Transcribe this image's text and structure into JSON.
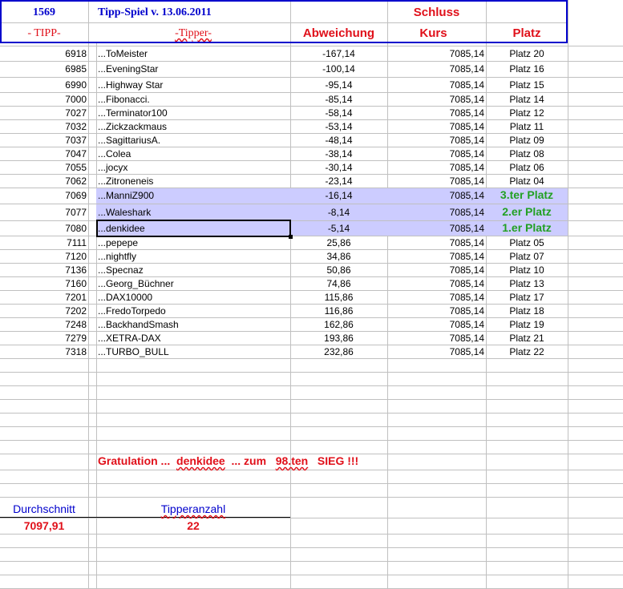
{
  "header": {
    "id": "1569",
    "title": "Tipp-Spiel v. 13.06.2011",
    "schluss": "Schluss",
    "col_tipp": "- TIPP-",
    "col_tipper": "-Tipper-",
    "col_abweichung": "Abweichung",
    "col_kurs": "Kurs",
    "col_platz": "Platz"
  },
  "rows": [
    {
      "tipp": "6918",
      "name": "...ToMeister",
      "abw": "-167,14",
      "kurs": "7085,14",
      "platz": "Platz 20"
    },
    {
      "tipp": "6985",
      "name": "...EveningStar",
      "abw": "-100,14",
      "kurs": "7085,14",
      "platz": "Platz 16"
    },
    {
      "tipp": "6990",
      "name": "...Highway Star",
      "abw": "-95,14",
      "kurs": "7085,14",
      "platz": "Platz 15"
    },
    {
      "tipp": "7000",
      "name": "...Fibonacci.",
      "abw": "-85,14",
      "kurs": "7085,14",
      "platz": "Platz 14"
    },
    {
      "tipp": "7027",
      "name": "...Terminator100",
      "abw": "-58,14",
      "kurs": "7085,14",
      "platz": "Platz 12"
    },
    {
      "tipp": "7032",
      "name": "...Zickzackmaus",
      "abw": "-53,14",
      "kurs": "7085,14",
      "platz": "Platz 11"
    },
    {
      "tipp": "7037",
      "name": "...SagittariusA.",
      "abw": "-48,14",
      "kurs": "7085,14",
      "platz": "Platz 09"
    },
    {
      "tipp": "7047",
      "name": "...Colea",
      "abw": "-38,14",
      "kurs": "7085,14",
      "platz": "Platz 08"
    },
    {
      "tipp": "7055",
      "name": "...jocyx",
      "abw": "-30,14",
      "kurs": "7085,14",
      "platz": "Platz 06"
    },
    {
      "tipp": "7062",
      "name": "...Zitroneneis",
      "abw": "-23,14",
      "kurs": "7085,14",
      "platz": "Platz 04"
    },
    {
      "tipp": "7069",
      "name": "...ManniZ900",
      "abw": "-16,14",
      "kurs": "7085,14",
      "platz": "3.ter Platz",
      "winner": true
    },
    {
      "tipp": "7077",
      "name": "...Waleshark",
      "abw": "-8,14",
      "kurs": "7085,14",
      "platz": "2.er Platz",
      "winner": true
    },
    {
      "tipp": "7080",
      "name": "...denkidee",
      "abw": "-5,14",
      "kurs": "7085,14",
      "platz": "1.er Platz",
      "winner": true,
      "selected": true
    },
    {
      "tipp": "7111",
      "name": "...pepepe",
      "abw": "25,86",
      "kurs": "7085,14",
      "platz": "Platz 05"
    },
    {
      "tipp": "7120",
      "name": "...nightfly",
      "abw": "34,86",
      "kurs": "7085,14",
      "platz": "Platz 07"
    },
    {
      "tipp": "7136",
      "name": "...Specnaz",
      "abw": "50,86",
      "kurs": "7085,14",
      "platz": "Platz 10"
    },
    {
      "tipp": "7160",
      "name": "...Georg_Büchner",
      "abw": "74,86",
      "kurs": "7085,14",
      "platz": "Platz 13"
    },
    {
      "tipp": "7201",
      "name": "...DAX10000",
      "abw": "115,86",
      "kurs": "7085,14",
      "platz": "Platz 17"
    },
    {
      "tipp": "7202",
      "name": "...FredoTorpedo",
      "abw": "116,86",
      "kurs": "7085,14",
      "platz": "Platz 18"
    },
    {
      "tipp": "7248",
      "name": "...BackhandSmash",
      "abw": "162,86",
      "kurs": "7085,14",
      "platz": "Platz 19"
    },
    {
      "tipp": "7279",
      "name": "...XETRA-DAX",
      "abw": "193,86",
      "kurs": "7085,14",
      "platz": "Platz 21"
    },
    {
      "tipp": "7318",
      "name": "...TURBO_BULL",
      "abw": "232,86",
      "kurs": "7085,14",
      "platz": "Platz 22"
    }
  ],
  "congrats": {
    "a": "Gratulation ...",
    "name": "denkidee",
    "b": "... zum",
    "count": "98.ten",
    "c": "SIEG !!!"
  },
  "summary": {
    "avg_label": "Durchschnitt",
    "avg_value": "7097,91",
    "count_label": "Tipperanzahl",
    "count_value": "22"
  },
  "colors": {
    "header_border": "#0000cc",
    "highlight": "#ccccff",
    "red": "#e0101a",
    "green": "#22a022"
  }
}
